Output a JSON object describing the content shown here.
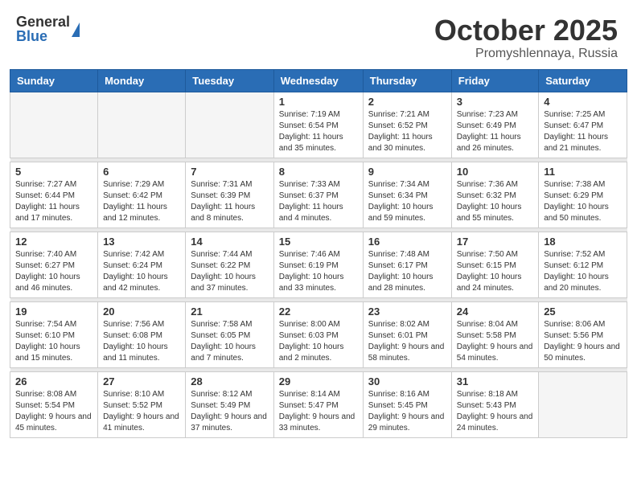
{
  "header": {
    "logo_general": "General",
    "logo_blue": "Blue",
    "month_title": "October 2025",
    "location": "Promyshlennaya, Russia"
  },
  "weekdays": [
    "Sunday",
    "Monday",
    "Tuesday",
    "Wednesday",
    "Thursday",
    "Friday",
    "Saturday"
  ],
  "weeks": [
    [
      {
        "day": "",
        "sunrise": "",
        "sunset": "",
        "daylight": "",
        "empty": true
      },
      {
        "day": "",
        "sunrise": "",
        "sunset": "",
        "daylight": "",
        "empty": true
      },
      {
        "day": "",
        "sunrise": "",
        "sunset": "",
        "daylight": "",
        "empty": true
      },
      {
        "day": "1",
        "sunrise": "Sunrise: 7:19 AM",
        "sunset": "Sunset: 6:54 PM",
        "daylight": "Daylight: 11 hours and 35 minutes."
      },
      {
        "day": "2",
        "sunrise": "Sunrise: 7:21 AM",
        "sunset": "Sunset: 6:52 PM",
        "daylight": "Daylight: 11 hours and 30 minutes."
      },
      {
        "day": "3",
        "sunrise": "Sunrise: 7:23 AM",
        "sunset": "Sunset: 6:49 PM",
        "daylight": "Daylight: 11 hours and 26 minutes."
      },
      {
        "day": "4",
        "sunrise": "Sunrise: 7:25 AM",
        "sunset": "Sunset: 6:47 PM",
        "daylight": "Daylight: 11 hours and 21 minutes."
      }
    ],
    [
      {
        "day": "5",
        "sunrise": "Sunrise: 7:27 AM",
        "sunset": "Sunset: 6:44 PM",
        "daylight": "Daylight: 11 hours and 17 minutes."
      },
      {
        "day": "6",
        "sunrise": "Sunrise: 7:29 AM",
        "sunset": "Sunset: 6:42 PM",
        "daylight": "Daylight: 11 hours and 12 minutes."
      },
      {
        "day": "7",
        "sunrise": "Sunrise: 7:31 AM",
        "sunset": "Sunset: 6:39 PM",
        "daylight": "Daylight: 11 hours and 8 minutes."
      },
      {
        "day": "8",
        "sunrise": "Sunrise: 7:33 AM",
        "sunset": "Sunset: 6:37 PM",
        "daylight": "Daylight: 11 hours and 4 minutes."
      },
      {
        "day": "9",
        "sunrise": "Sunrise: 7:34 AM",
        "sunset": "Sunset: 6:34 PM",
        "daylight": "Daylight: 10 hours and 59 minutes."
      },
      {
        "day": "10",
        "sunrise": "Sunrise: 7:36 AM",
        "sunset": "Sunset: 6:32 PM",
        "daylight": "Daylight: 10 hours and 55 minutes."
      },
      {
        "day": "11",
        "sunrise": "Sunrise: 7:38 AM",
        "sunset": "Sunset: 6:29 PM",
        "daylight": "Daylight: 10 hours and 50 minutes."
      }
    ],
    [
      {
        "day": "12",
        "sunrise": "Sunrise: 7:40 AM",
        "sunset": "Sunset: 6:27 PM",
        "daylight": "Daylight: 10 hours and 46 minutes."
      },
      {
        "day": "13",
        "sunrise": "Sunrise: 7:42 AM",
        "sunset": "Sunset: 6:24 PM",
        "daylight": "Daylight: 10 hours and 42 minutes."
      },
      {
        "day": "14",
        "sunrise": "Sunrise: 7:44 AM",
        "sunset": "Sunset: 6:22 PM",
        "daylight": "Daylight: 10 hours and 37 minutes."
      },
      {
        "day": "15",
        "sunrise": "Sunrise: 7:46 AM",
        "sunset": "Sunset: 6:19 PM",
        "daylight": "Daylight: 10 hours and 33 minutes."
      },
      {
        "day": "16",
        "sunrise": "Sunrise: 7:48 AM",
        "sunset": "Sunset: 6:17 PM",
        "daylight": "Daylight: 10 hours and 28 minutes."
      },
      {
        "day": "17",
        "sunrise": "Sunrise: 7:50 AM",
        "sunset": "Sunset: 6:15 PM",
        "daylight": "Daylight: 10 hours and 24 minutes."
      },
      {
        "day": "18",
        "sunrise": "Sunrise: 7:52 AM",
        "sunset": "Sunset: 6:12 PM",
        "daylight": "Daylight: 10 hours and 20 minutes."
      }
    ],
    [
      {
        "day": "19",
        "sunrise": "Sunrise: 7:54 AM",
        "sunset": "Sunset: 6:10 PM",
        "daylight": "Daylight: 10 hours and 15 minutes."
      },
      {
        "day": "20",
        "sunrise": "Sunrise: 7:56 AM",
        "sunset": "Sunset: 6:08 PM",
        "daylight": "Daylight: 10 hours and 11 minutes."
      },
      {
        "day": "21",
        "sunrise": "Sunrise: 7:58 AM",
        "sunset": "Sunset: 6:05 PM",
        "daylight": "Daylight: 10 hours and 7 minutes."
      },
      {
        "day": "22",
        "sunrise": "Sunrise: 8:00 AM",
        "sunset": "Sunset: 6:03 PM",
        "daylight": "Daylight: 10 hours and 2 minutes."
      },
      {
        "day": "23",
        "sunrise": "Sunrise: 8:02 AM",
        "sunset": "Sunset: 6:01 PM",
        "daylight": "Daylight: 9 hours and 58 minutes."
      },
      {
        "day": "24",
        "sunrise": "Sunrise: 8:04 AM",
        "sunset": "Sunset: 5:58 PM",
        "daylight": "Daylight: 9 hours and 54 minutes."
      },
      {
        "day": "25",
        "sunrise": "Sunrise: 8:06 AM",
        "sunset": "Sunset: 5:56 PM",
        "daylight": "Daylight: 9 hours and 50 minutes."
      }
    ],
    [
      {
        "day": "26",
        "sunrise": "Sunrise: 8:08 AM",
        "sunset": "Sunset: 5:54 PM",
        "daylight": "Daylight: 9 hours and 45 minutes."
      },
      {
        "day": "27",
        "sunrise": "Sunrise: 8:10 AM",
        "sunset": "Sunset: 5:52 PM",
        "daylight": "Daylight: 9 hours and 41 minutes."
      },
      {
        "day": "28",
        "sunrise": "Sunrise: 8:12 AM",
        "sunset": "Sunset: 5:49 PM",
        "daylight": "Daylight: 9 hours and 37 minutes."
      },
      {
        "day": "29",
        "sunrise": "Sunrise: 8:14 AM",
        "sunset": "Sunset: 5:47 PM",
        "daylight": "Daylight: 9 hours and 33 minutes."
      },
      {
        "day": "30",
        "sunrise": "Sunrise: 8:16 AM",
        "sunset": "Sunset: 5:45 PM",
        "daylight": "Daylight: 9 hours and 29 minutes."
      },
      {
        "day": "31",
        "sunrise": "Sunrise: 8:18 AM",
        "sunset": "Sunset: 5:43 PM",
        "daylight": "Daylight: 9 hours and 24 minutes."
      },
      {
        "day": "",
        "sunrise": "",
        "sunset": "",
        "daylight": "",
        "empty": true
      }
    ]
  ]
}
